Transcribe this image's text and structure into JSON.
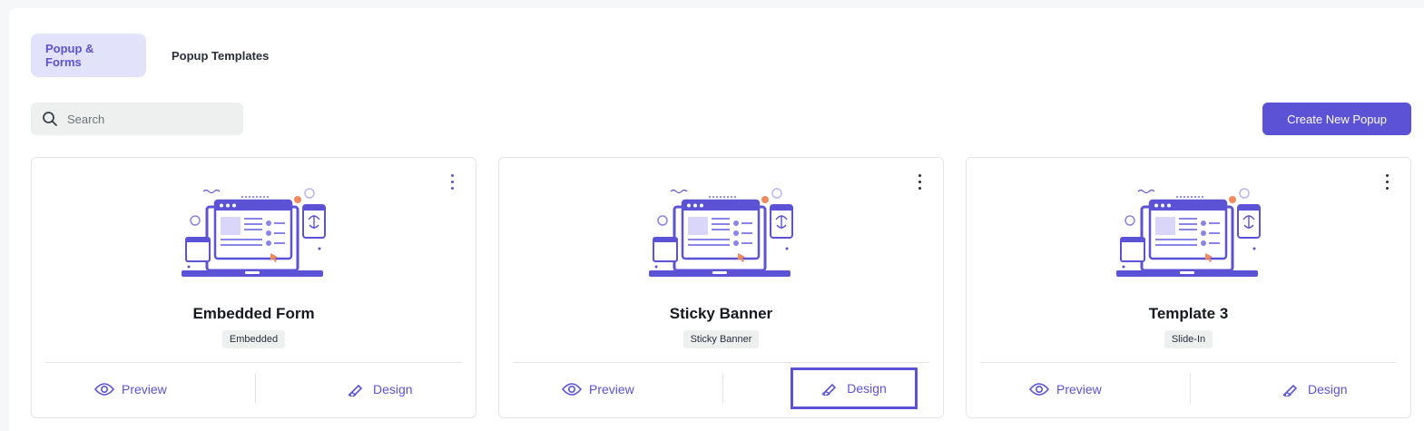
{
  "tabs": [
    {
      "label": "Popup & Forms",
      "active": true
    },
    {
      "label": "Popup Templates",
      "active": false
    }
  ],
  "search": {
    "placeholder": "Search",
    "icon": "search-icon"
  },
  "create_button": {
    "label": "Create New Popup"
  },
  "cards": [
    {
      "title": "Embedded Form",
      "tag": "Embedded",
      "preview_label": "Preview",
      "design_label": "Design",
      "focused": false
    },
    {
      "title": "Sticky Banner",
      "tag": "Sticky Banner",
      "preview_label": "Preview",
      "design_label": "Design",
      "focused": true
    },
    {
      "title": "Template 3",
      "tag": "Slide-In",
      "preview_label": "Preview",
      "design_label": "Design",
      "focused": false
    }
  ],
  "colors": {
    "accent": "#5b52d6",
    "tab_active_bg": "#e3e2fb",
    "illustration_orange": "#f08a5d",
    "illustration_light": "#d9d6fa"
  }
}
